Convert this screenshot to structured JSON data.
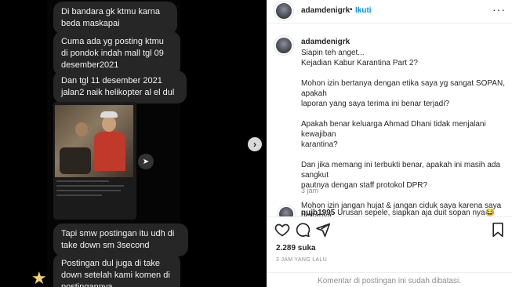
{
  "chat": {
    "messages": [
      "Di bandara gk ktmu karna beda maskapai",
      "Cuma ada yg posting ktmu di pondok indah mall tgl 09 desember2021",
      "Dan tgl 11 desember 2021 jalan2 naik helikopter al el dul",
      "Tapi smw postingan itu udh di take down sm 3second",
      "Postingan dul juga di take down setelah kami komen di postingannya"
    ]
  },
  "post": {
    "username": "adamdenigrk",
    "follow_label": "Ikuti",
    "dot": "•",
    "caption_user": "adamdenigrk",
    "caption": "Siapin teh anget...\nKejadian Kabur Karantina Part 2?\n\nMohon izin bertanya dengan etika saya yg sangat SOPAN, apakah\nlaporan yang saya terima ini benar terjadi?\n\nApakah benar keluarga Ahmad Dhani tidak menjalani kewajiban\nkarantina?\n\nDan jika memang ini terbukti benar, apakah ini masih ada sangkut\npautnya dengan staff protokol DPR?\n\nMohon izin jangan hujat & jangan ciduk saya karena saya bertanya\ndengan sangat SOPAN.⁠",
    "caption_time": "3 jam",
    "comment_user": "nujb1995",
    "comment_text": "Urusan sepele, siapkan aja duit sopan nya😂",
    "likes": "2.289 suka",
    "posted": "3 JAM YANG LALU",
    "comments_closed": "Komentar di postingan ini sudah dibatasi."
  }
}
